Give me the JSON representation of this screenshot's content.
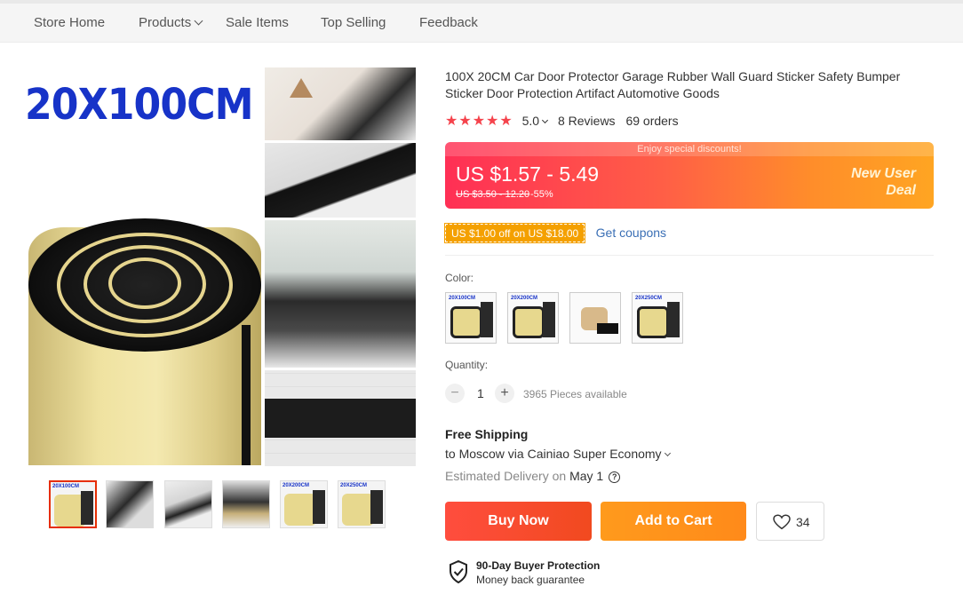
{
  "nav": {
    "items": [
      "Store Home",
      "Products",
      "Sale Items",
      "Top Selling",
      "Feedback"
    ]
  },
  "gallery": {
    "main_label": "20X100CM",
    "thumb_labels": [
      "20X100CM",
      "",
      "",
      "",
      "20X200CM",
      "20X250CM"
    ]
  },
  "product": {
    "title": "100X 20CM Car Door Protector Garage Rubber Wall Guard Sticker Safety Bumper Sticker Door Protection Artifact Automotive Goods",
    "stars": "★★★★★",
    "score": "5.0",
    "reviews": "8 Reviews",
    "orders": "69 orders"
  },
  "price": {
    "banner": "Enjoy special discounts!",
    "range": "US $1.57 - 5.49",
    "original": "US $3.50 - 12.20",
    "discount": "-55%",
    "deal_line1": "New User",
    "deal_line2": "Deal",
    "accent": "#ff2f55"
  },
  "coupon": {
    "tag": "US $1.00 off on US $18.00",
    "link": "Get coupons"
  },
  "color": {
    "label": "Color:",
    "options": [
      "20X100CM",
      "20X200CM",
      "",
      "20X250CM"
    ]
  },
  "quantity": {
    "label": "Quantity:",
    "minus": "−",
    "plus": "+",
    "value": "1",
    "available": "3965 Pieces available"
  },
  "shipping": {
    "title": "Free Shipping",
    "to": "to Moscow via Cainiao Super Economy",
    "estimated": "Estimated Delivery on",
    "date": "May 1",
    "help": "?"
  },
  "actions": {
    "buy_now": "Buy Now",
    "add_to_cart": "Add to Cart",
    "wishlist_count": "34",
    "buy_color": "#f14a1f",
    "cart_color": "#ff8a1a"
  },
  "protection": {
    "title": "90-Day Buyer Protection",
    "subtitle": "Money back guarantee"
  }
}
